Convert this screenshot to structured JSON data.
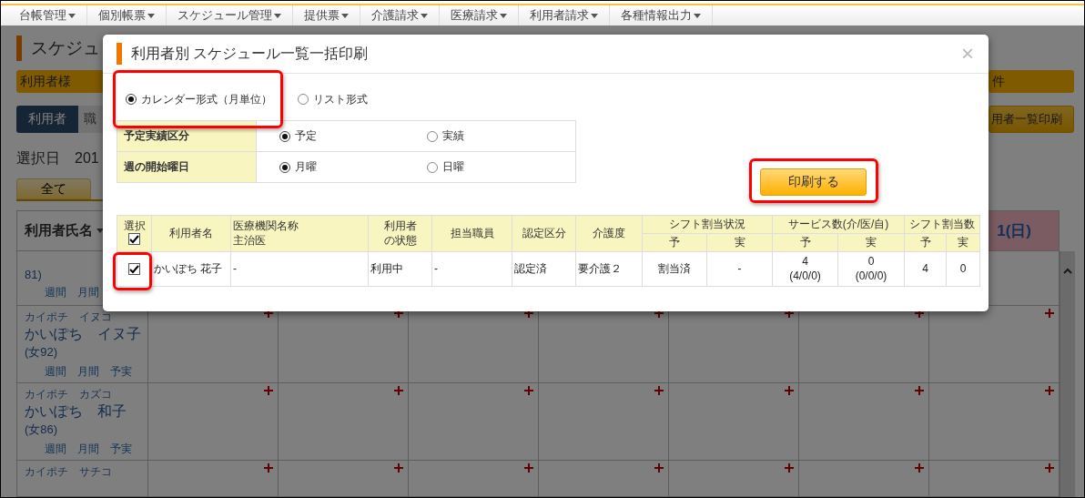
{
  "menu": [
    {
      "label": "台帳管理"
    },
    {
      "label": "個別帳票"
    },
    {
      "label": "スケジュール管理"
    },
    {
      "label": "提供票"
    },
    {
      "label": "介護請求"
    },
    {
      "label": "医療請求"
    },
    {
      "label": "利用者請求"
    },
    {
      "label": "各種情報出力"
    }
  ],
  "page": {
    "title": "スケジュ",
    "user_button": "利用者様",
    "condition_button": "件",
    "tabs": [
      {
        "label": "利用者",
        "selected": true
      },
      {
        "label": "職",
        "selected": false
      }
    ],
    "print_list_button": "用者一覧印刷",
    "selected_date": "選択日　201",
    "filter_tabs": [
      {
        "label": "全て",
        "selected": true
      }
    ]
  },
  "grid": {
    "name_header": "利用者氏名",
    "day_header": "1(日)",
    "rows": [
      {
        "age": "81)",
        "links": [
          "週間",
          "月間"
        ],
        "covered": true
      },
      {
        "kana": "カイポチ　イヌコ",
        "name": "かいぽち　イヌ子",
        "age": "(女92)",
        "links": [
          "週間",
          "月間",
          "予実"
        ],
        "covered": false
      },
      {
        "kana": "カイポチ　カズコ",
        "name": "かいぽち　和子",
        "age": "(女86)",
        "links": [
          "週間",
          "月間",
          "予実"
        ],
        "covered": false
      },
      {
        "kana": "カイポチ　サチコ",
        "links": [],
        "covered": false
      }
    ]
  },
  "dialog": {
    "title": "利用者別 スケジュール一覧一括印刷",
    "close": "×",
    "formats": [
      {
        "label": "カレンダー形式（月単位）",
        "selected": true,
        "highlighted": true
      },
      {
        "label": "リスト形式",
        "selected": false,
        "highlighted": false
      }
    ],
    "options": [
      {
        "label": "予定実績区分",
        "choices": [
          {
            "label": "予定",
            "selected": true
          },
          {
            "label": "実績",
            "selected": false
          }
        ]
      },
      {
        "label": "週の開始曜日",
        "choices": [
          {
            "label": "月曜",
            "selected": true
          },
          {
            "label": "日曜",
            "selected": false
          }
        ]
      }
    ],
    "print_button": {
      "label": "印刷する",
      "highlighted": true
    },
    "table": {
      "select_all_checked": true,
      "header_rows": [
        [
          {
            "lines": [
              "選択"
            ],
            "rowspan": 2,
            "kind": "select"
          },
          {
            "lines": [
              "利用者名"
            ],
            "rowspan": 2
          },
          {
            "lines": [
              "医療機関名称",
              "主治医"
            ],
            "rowspan": 2
          },
          {
            "lines": [
              "利用者",
              "の状態"
            ],
            "rowspan": 2
          },
          {
            "lines": [
              "担当職員"
            ],
            "rowspan": 2
          },
          {
            "lines": [
              "認定区分"
            ],
            "rowspan": 2
          },
          {
            "lines": [
              "介護度"
            ],
            "rowspan": 2
          },
          {
            "lines": [
              "シフト割当状況"
            ],
            "colspan": 2
          },
          {
            "lines": [
              "サービス数(介/医/自)"
            ],
            "colspan": 2
          },
          {
            "lines": [
              "シフト割当数"
            ],
            "colspan": 2
          }
        ],
        [
          {
            "lines": [
              "予"
            ]
          },
          {
            "lines": [
              "実"
            ]
          },
          {
            "lines": [
              "予"
            ]
          },
          {
            "lines": [
              "実"
            ]
          },
          {
            "lines": [
              "予"
            ]
          },
          {
            "lines": [
              "実"
            ]
          }
        ]
      ],
      "rows": [
        {
          "checked": true,
          "highlighted": true,
          "cells": [
            "かいぽち 花子",
            "-",
            "利用中",
            "-",
            "認定済",
            "要介護２",
            "割当済",
            "-",
            "4\n(4/0/0)",
            "0\n(0/0/0)",
            "4",
            "0"
          ]
        }
      ]
    }
  }
}
